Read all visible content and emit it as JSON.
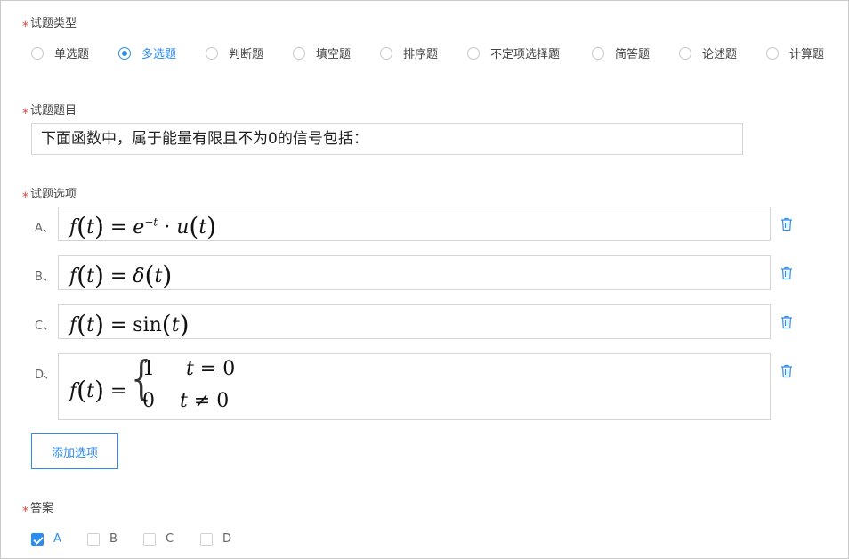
{
  "question_type": {
    "label": "试题类型",
    "required_mark": "*",
    "options": [
      "单选题",
      "多选题",
      "判断题",
      "填空题",
      "排序题",
      "不定项选择题",
      "简答题",
      "论述题",
      "计算题"
    ],
    "selected": "多选题"
  },
  "question_title": {
    "label": "试题题目",
    "required_mark": "*",
    "value": "下面函数中，属于能量有限且不为0的信号包括："
  },
  "question_options": {
    "label": "试题选项",
    "required_mark": "*",
    "items": [
      {
        "letter": "A、",
        "formula": "f(t) = e^{-t} · u(t)"
      },
      {
        "letter": "B、",
        "formula": "f(t) = δ(t)"
      },
      {
        "letter": "C、",
        "formula": "f(t) = sin(t)"
      },
      {
        "letter": "D、",
        "formula": "f(t) = {1  t = 0; 0  t ≠ 0}"
      }
    ],
    "delete_icon": "trash-icon",
    "add_button": "添加选项"
  },
  "answer": {
    "label": "答案",
    "required_mark": "*",
    "choices": [
      {
        "label": "A",
        "checked": true
      },
      {
        "label": "B",
        "checked": false
      },
      {
        "label": "C",
        "checked": false
      },
      {
        "label": "D",
        "checked": false
      }
    ]
  },
  "colors": {
    "accent": "#2d8cf0",
    "required": "#e0482f",
    "border": "#d5d5d5"
  }
}
